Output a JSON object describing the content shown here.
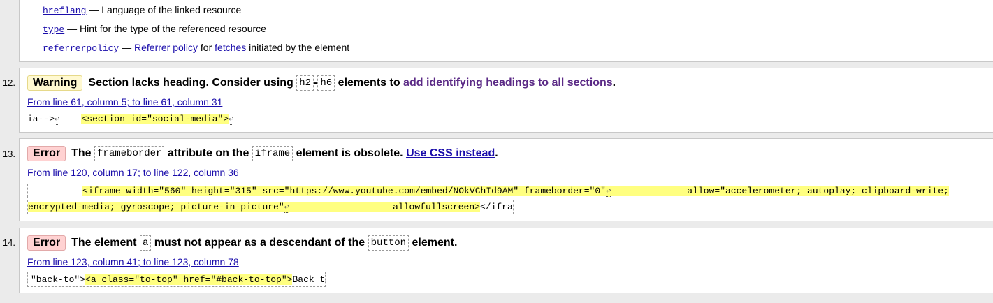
{
  "top": {
    "attrs": [
      {
        "name": "hreflang",
        "sep": " — ",
        "desc": "Language of the linked resource"
      },
      {
        "name": "type",
        "sep": " — ",
        "desc": "Hint for the type of the referenced resource"
      }
    ],
    "referrer": {
      "name": "referrerpolicy",
      "sep": " — ",
      "link1": "Referrer policy",
      "mid": " for ",
      "link2": "fetches",
      "tail": " initiated by the element"
    }
  },
  "items": [
    {
      "num": "12.",
      "badge": "Warning",
      "msg_a": "Section lacks heading. Consider using",
      "code1": "h2",
      "dash": "-",
      "code2": "h6",
      "msg_b": "elements to",
      "link": "add identifying headings to all sections",
      "msg_end": ".",
      "location": "From line 61, column 5; to line 61, column 31",
      "extract_pre": "ia-->",
      "extract_ret1": "↩",
      "extract_space": "    ",
      "extract_hl": "<section id=\"social-media\">",
      "extract_ret2": "↩"
    },
    {
      "num": "13.",
      "badge": "Error",
      "msg_a": "The",
      "code1": "frameborder",
      "msg_b": "attribute on the",
      "code2": "iframe",
      "msg_c": "element is obsolete.",
      "link": "Use CSS instead",
      "msg_end": ".",
      "location": "From line 120, column 17; to line 122, column 36",
      "extract_line1_pre": "          ",
      "extract_line1_hl": "<iframe width=\"560\" height=\"315\" src=\"https://www.youtube.com/embed/NOkVChId9AM\" frameborder=\"0\"",
      "extract_line1_ret": "↩",
      "extract_line1_hl2": "              allow=\"accelerometer; autoplay; clipboard-write;",
      "extract_line2_hl": "encrypted-media; gyroscope; picture-in-picture\"",
      "extract_line2_ret": "↩",
      "extract_line2_hl2": "                   allowfullscreen>",
      "extract_line2_post": "</ifra"
    },
    {
      "num": "14.",
      "badge": "Error",
      "msg_a": "The element",
      "code1": "a",
      "msg_b": "must not appear as a descendant of the",
      "code2": "button",
      "msg_c": "element.",
      "location": "From line 123, column 41; to line 123, column 78",
      "extract_pre": "\"back-to\">",
      "extract_hl": "<a class=\"to-top\" href=\"#back-to-top\">",
      "extract_post": "Back t"
    }
  ],
  "colors": {
    "highlight": "#ffff80",
    "warning_badge": "#fff9d1",
    "error_badge": "#ffd2d2",
    "link": "#1a0dab",
    "visited_link": "#5b2a86"
  }
}
